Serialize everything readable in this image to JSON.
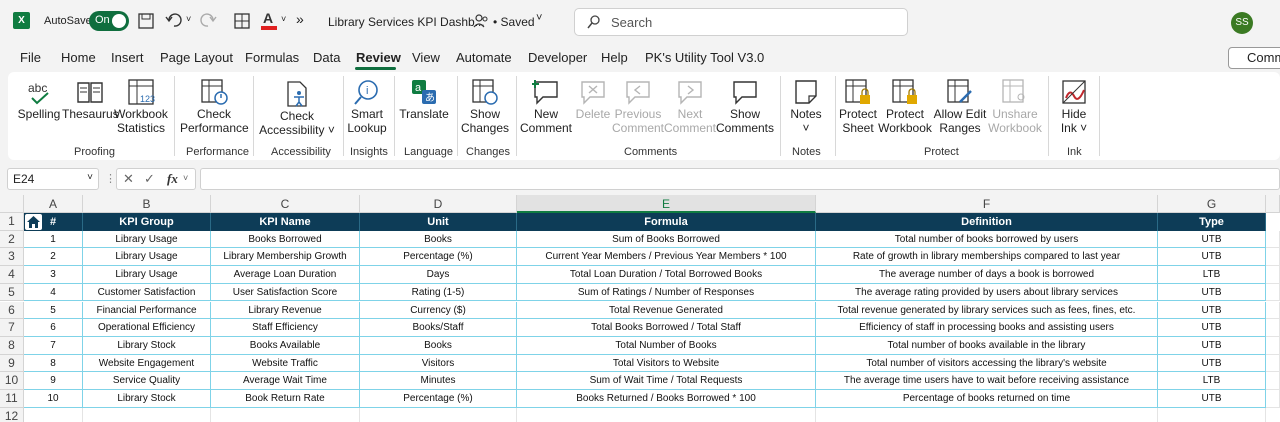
{
  "titlebar": {
    "app_icon": "excel-icon",
    "autosave_label": "AutoSave",
    "autosave_state": "On",
    "file_title": "Library Services KPI Dashb...",
    "saved_status": "• Saved",
    "search_placeholder": "Search",
    "user_initials": "SS"
  },
  "menu": [
    "File",
    "Home",
    "Insert",
    "Page Layout",
    "Formulas",
    "Data",
    "Review",
    "View",
    "Automate",
    "Developer",
    "Help",
    "PK's Utility Tool V3.0"
  ],
  "active_menu": "Review",
  "comments_button": "Comm",
  "ribbon": {
    "buttons": {
      "spelling": "Spelling",
      "thesaurus": "Thesaurus",
      "workbook_stats": "Workbook\nStatistics",
      "check_perf": "Check\nPerformance",
      "check_access": "Check\nAccessibility ˅",
      "smart_lookup": "Smart\nLookup",
      "translate": "Translate",
      "show_changes": "Show\nChanges",
      "new_comment": "New\nComment",
      "delete": "Delete",
      "previous_comment": "Previous\nComment",
      "next_comment": "Next\nComment",
      "show_comments": "Show\nComments",
      "notes": "Notes\n˅",
      "protect_sheet": "Protect\nSheet",
      "protect_workbook": "Protect\nWorkbook",
      "allow_edit_ranges": "Allow Edit\nRanges",
      "unshare_workbook": "Unshare\nWorkbook",
      "hide_ink": "Hide\nInk ˅"
    },
    "groups": {
      "proofing": "Proofing",
      "performance": "Performance",
      "accessibility": "Accessibility",
      "insights": "Insights",
      "language": "Language",
      "changes": "Changes",
      "comments": "Comments",
      "notes": "Notes",
      "protect": "Protect",
      "ink": "Ink"
    }
  },
  "formula_bar": {
    "name_box": "E24",
    "fx": "fx",
    "formula": ""
  },
  "sheet": {
    "columns": [
      "A",
      "B",
      "C",
      "D",
      "E",
      "F",
      "G"
    ],
    "selected_column": "E",
    "row_numbers": [
      "1",
      "2",
      "3",
      "4",
      "5",
      "6",
      "7",
      "8",
      "9",
      "10",
      "11",
      "12"
    ],
    "header": [
      "#",
      "KPI Group",
      "KPI Name",
      "Unit",
      "Formula",
      "Definition",
      "Type"
    ],
    "rows": [
      [
        "1",
        "Library Usage",
        "Books Borrowed",
        "Books",
        "Sum of Books Borrowed",
        "Total number of books borrowed by users",
        "UTB"
      ],
      [
        "2",
        "Library Usage",
        "Library Membership Growth",
        "Percentage (%)",
        "Current Year Members / Previous Year Members * 100",
        "Rate of growth in library memberships compared to last year",
        "UTB"
      ],
      [
        "3",
        "Library Usage",
        "Average Loan Duration",
        "Days",
        "Total Loan Duration / Total Borrowed Books",
        "The average number of days a book is borrowed",
        "LTB"
      ],
      [
        "4",
        "Customer Satisfaction",
        "User Satisfaction Score",
        "Rating (1-5)",
        "Sum of Ratings / Number of Responses",
        "The average rating provided by users about library services",
        "UTB"
      ],
      [
        "5",
        "Financial Performance",
        "Library Revenue",
        "Currency ($)",
        "Total Revenue Generated",
        "Total revenue generated by library services such as fees, fines, etc.",
        "UTB"
      ],
      [
        "6",
        "Operational Efficiency",
        "Staff Efficiency",
        "Books/Staff",
        "Total Books Borrowed / Total Staff",
        "Efficiency of staff in processing books and assisting users",
        "UTB"
      ],
      [
        "7",
        "Library Stock",
        "Books Available",
        "Books",
        "Total Number of Books",
        "Total number of books available in the library",
        "UTB"
      ],
      [
        "8",
        "Website Engagement",
        "Website Traffic",
        "Visitors",
        "Total Visitors to Website",
        "Total number of visitors accessing the library's website",
        "UTB"
      ],
      [
        "9",
        "Service Quality",
        "Average Wait Time",
        "Minutes",
        "Sum of Wait Time / Total Requests",
        "The average time users have to wait before receiving assistance",
        "LTB"
      ],
      [
        "10",
        "Library Stock",
        "Book Return Rate",
        "Percentage (%)",
        "Books Returned / Books Borrowed * 100",
        "Percentage of books returned on time",
        "UTB"
      ]
    ]
  },
  "colors": {
    "accent": "#107c41",
    "header_fill": "#0d3c57",
    "grid_border": "#7fd3e8"
  }
}
